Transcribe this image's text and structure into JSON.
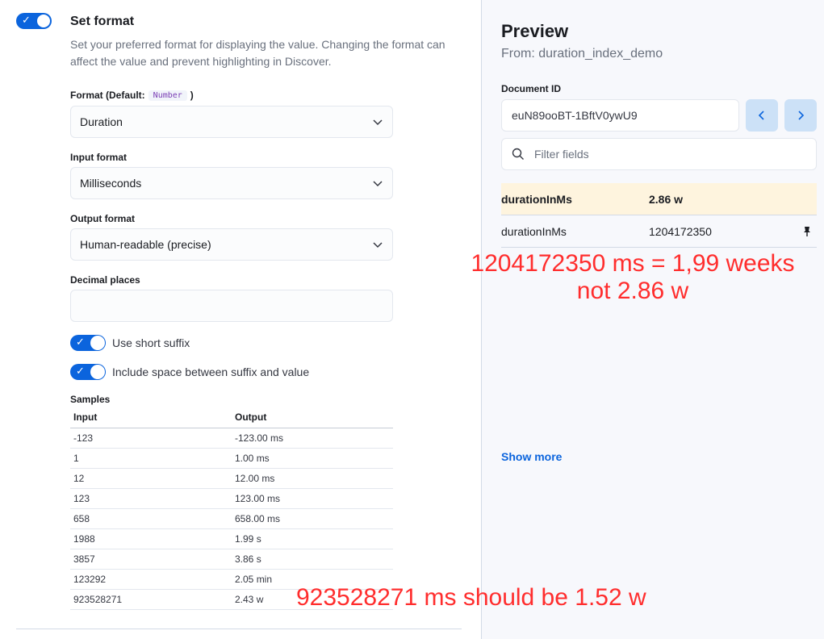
{
  "set_format": {
    "title": "Set format",
    "description": "Set your preferred format for displaying the value. Changing the format can affect the value and prevent highlighting in Discover."
  },
  "format": {
    "label_prefix": "Format (Default:",
    "default_badge": "Number",
    "label_suffix": ")",
    "value": "Duration"
  },
  "input_format": {
    "label": "Input format",
    "value": "Milliseconds"
  },
  "output_format": {
    "label": "Output format",
    "value": "Human-readable (precise)"
  },
  "decimal_places": {
    "label": "Decimal places",
    "value": ""
  },
  "short_suffix": {
    "label": "Use short suffix"
  },
  "include_space": {
    "label": "Include space between suffix and value"
  },
  "samples": {
    "label": "Samples",
    "headers": [
      "Input",
      "Output"
    ],
    "rows": [
      [
        "-123",
        "-123.00 ms"
      ],
      [
        "1",
        "1.00 ms"
      ],
      [
        "12",
        "12.00 ms"
      ],
      [
        "123",
        "123.00 ms"
      ],
      [
        "658",
        "658.00 ms"
      ],
      [
        "1988",
        "1.99 s"
      ],
      [
        "3857",
        "3.86 s"
      ],
      [
        "123292",
        "2.05 min"
      ],
      [
        "923528271",
        "2.43 w"
      ]
    ]
  },
  "preview": {
    "title": "Preview",
    "subtitle": "From: duration_index_demo",
    "doc_id_label": "Document ID",
    "doc_id_value": "euN89ooBT-1BftV0ywU9",
    "filter_placeholder": "Filter fields",
    "fields": [
      {
        "name": "durationInMs",
        "value": "2.86 w"
      },
      {
        "name": "durationInMs",
        "value": "1204172350"
      }
    ],
    "show_more": "Show more"
  },
  "annotations": {
    "note1_line1": "1204172350 ms = 1,99 weeks",
    "note1_line2": "not 2.86 w",
    "note2": "923528271 ms should be 1.52 w",
    "color": "#ff2d2d"
  },
  "colors": {
    "accent": "#0b64dd",
    "highlight_row": "#fef4de"
  }
}
